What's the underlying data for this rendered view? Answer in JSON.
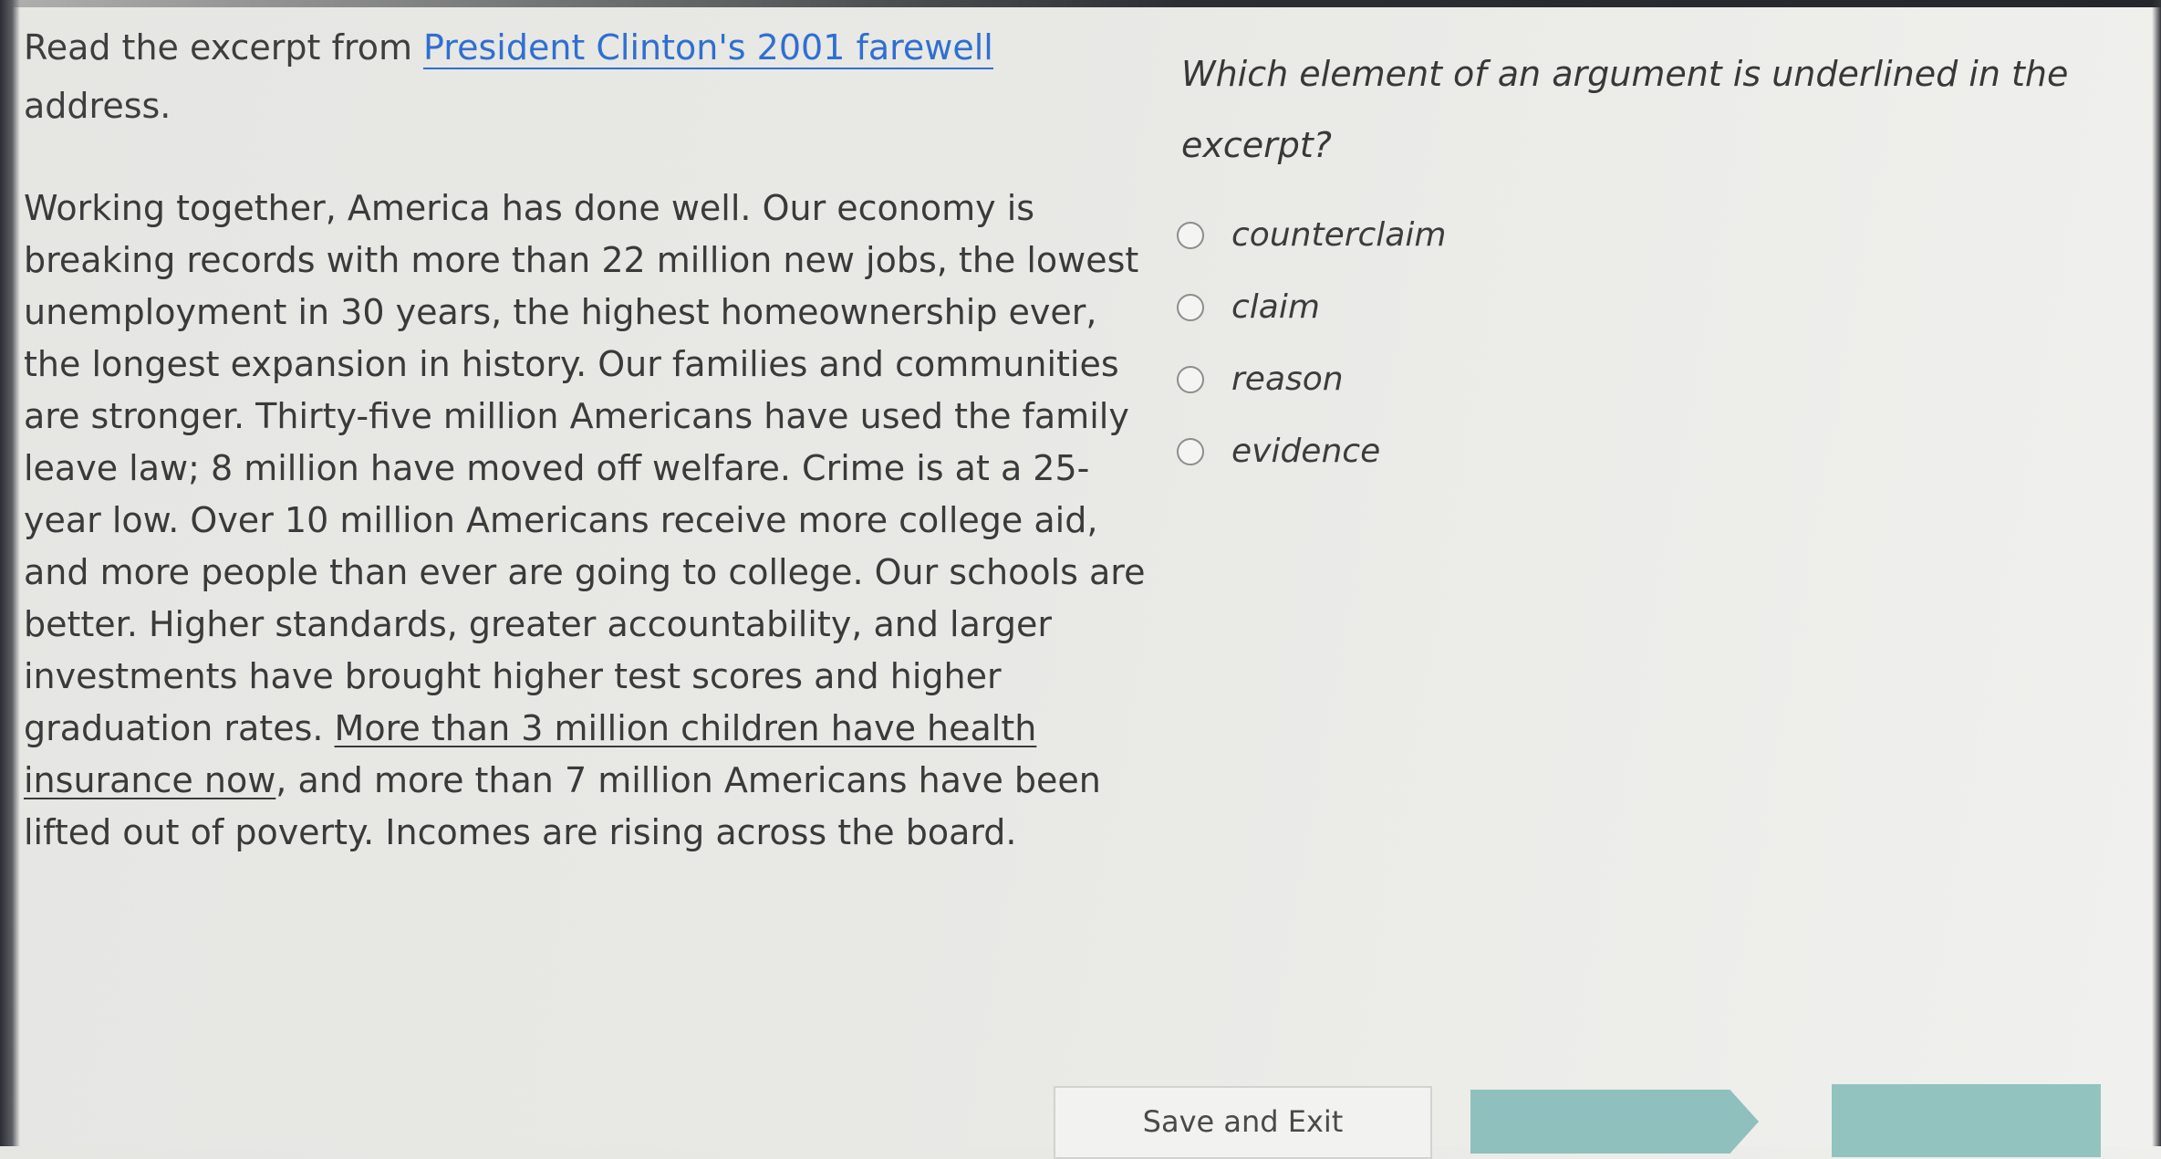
{
  "prompt": {
    "pre": "Read the excerpt from ",
    "link": "President Clinton's 2001 farewell",
    "post": " address."
  },
  "passage": {
    "part1": "Working together, America has done well. Our economy is breaking records with more than 22 million new jobs, the lowest unemployment in 30 years, the highest homeownership ever, the longest expansion in history. Our families and communities are stronger. Thirty-five million Americans have used the family leave law; 8 million have moved off welfare. Crime is at a 25-year low. Over 10 million Americans receive more college aid, and more people than ever are going to college. Our schools are better. Higher standards, greater accountability, and larger investments have brought higher test scores and higher graduation rates. ",
    "underlined": "More than 3 million children have health insurance now",
    "part2": ", and more than 7 million Americans have been lifted out of poverty. Incomes are rising across the board."
  },
  "question": "Which element of an argument is underlined in the excerpt?",
  "options": [
    {
      "label": "counterclaim"
    },
    {
      "label": "claim"
    },
    {
      "label": "reason"
    },
    {
      "label": "evidence"
    }
  ],
  "footer": {
    "save_exit_label": "Save and Exit"
  },
  "colors": {
    "link": "#2f6fd1",
    "next_button": "#8fc0bd",
    "submit_button": "#92c3bf"
  }
}
